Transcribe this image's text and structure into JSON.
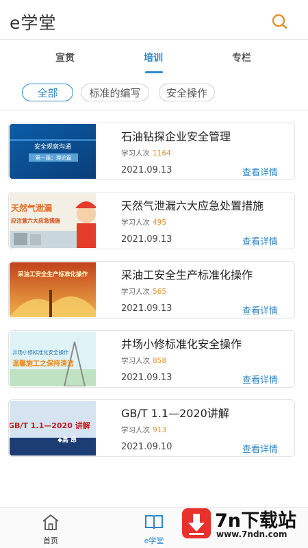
{
  "header": {
    "title": "e学堂",
    "search_icon": "search-icon",
    "accent_color": "#e0932a"
  },
  "tabs": [
    {
      "label": "宣贯",
      "active": false
    },
    {
      "label": "培训",
      "active": true
    },
    {
      "label": "专栏",
      "active": false
    }
  ],
  "filters": [
    {
      "label": "全部",
      "active": true
    },
    {
      "label": "标准的编写",
      "active": false
    },
    {
      "label": "安全操作",
      "active": false
    }
  ],
  "courses": [
    {
      "title": "石油钻探企业安全管理",
      "learners_label": "学习人次",
      "learners": "1164",
      "date": "2021.09.13",
      "link": "查看详情",
      "thumb_text": [
        "安全观察沟通",
        "第一篇：理论篇"
      ]
    },
    {
      "title": "天然气泄漏六大应急处置措施",
      "learners_label": "学习人次",
      "learners": "495",
      "date": "2021.09.13",
      "link": "查看详情",
      "thumb_text": [
        "天然气泄漏",
        "应注意六大应急措施"
      ]
    },
    {
      "title": "采油工安全生产标准化操作",
      "learners_label": "学习人次",
      "learners": "565",
      "date": "2021.09.13",
      "link": "查看详情",
      "thumb_text": [
        "采油工安全生产标准化操作"
      ]
    },
    {
      "title": "井场小修标准化安全操作",
      "learners_label": "学习人次",
      "learners": "858",
      "date": "2021.09.13",
      "link": "查看详情",
      "thumb_text": [
        "井场小修标准化安全操作",
        "温馨施工之保持清洁"
      ]
    },
    {
      "title": "GB/T 1.1—2020讲解",
      "learners_label": "学习人次",
      "learners": "913",
      "date": "2021.09.10",
      "link": "查看详情",
      "thumb_text": [
        "GB/T 1.1—2020 讲解",
        "◆高 昂"
      ]
    }
  ],
  "bottom_nav": [
    {
      "label": "首页",
      "icon": "home-icon",
      "active": false
    },
    {
      "label": "e学堂",
      "icon": "book-icon",
      "active": true
    }
  ],
  "watermark": {
    "name": "7n下载站",
    "url": "www.7ndn.com"
  },
  "colors": {
    "primary": "#2e87c8",
    "count": "#e0932a",
    "watermark_red": "#e8312b"
  }
}
